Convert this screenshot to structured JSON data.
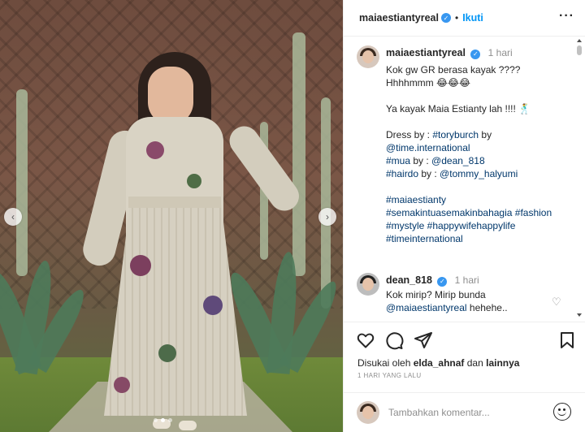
{
  "header": {
    "username": "maiaestiantyreal",
    "separator": "•",
    "follow_label": "Ikuti",
    "more_icon": "more-horizontal-icon",
    "verified_icon": "verified-badge-icon"
  },
  "caption": {
    "username": "maiaestiantyreal",
    "time": "1 hari",
    "lines": [
      "Kok gw GR berasa kayak ????",
      "Hhhhmmm 😂😂😂",
      "",
      "Ya kayak Maia Estianty lah !!!! 🕺",
      "",
      "Dress by : #toryburch by",
      "@time.international",
      "#mua by : @dean_818",
      "#hairdo by : @tommy_halyumi",
      "",
      "#maiaestianty",
      "#semakintuasemakinbahagia #fashion",
      "#mystyle #happywifehappylife",
      "#timeinternational"
    ]
  },
  "comment": {
    "username": "dean_818",
    "time": "1 hari",
    "line1": "Kok mirip? Mirip bunda",
    "mention": "@maiaestiantyreal",
    "line2_rest": " hehehe.."
  },
  "likes": {
    "prefix": "Disukai oleh ",
    "user": "elda_ahnaf",
    "middle": " dan ",
    "others": "lainnya"
  },
  "date": "1 HARI YANG LALU",
  "add_comment": {
    "placeholder": "Tambahkan komentar..."
  },
  "carousel": {
    "prev_icon": "chevron-left-icon",
    "next_icon": "chevron-right-icon",
    "slide_count": 3,
    "active_slide": 2
  },
  "colors": {
    "link": "#00376b",
    "follow": "#0095f6",
    "verified": "#3897f0",
    "muted": "#8e8e8e"
  }
}
